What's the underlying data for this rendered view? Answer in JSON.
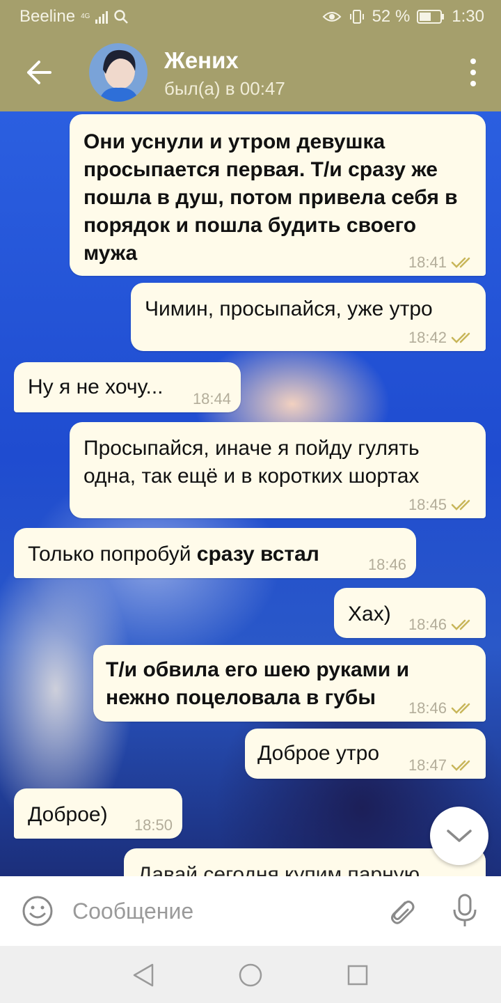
{
  "status_bar": {
    "carrier": "Beeline",
    "network": "4G",
    "battery": "52 %",
    "time": "1:30"
  },
  "header": {
    "contact_name": "Жених",
    "last_seen": "был(а) в 00:47"
  },
  "messages": [
    {
      "direction": "out",
      "text": "Они уснули и утром девушка просыпается первая. Т/и сразу же пошла в душ, потом привела себя в порядок и пошла будить своего мужа",
      "bold": true,
      "time": "18:41",
      "read": true
    },
    {
      "direction": "out",
      "text": "Чимин, просыпайся, уже утро",
      "bold": false,
      "time": "18:42",
      "read": true
    },
    {
      "direction": "in",
      "text": "Ну я не хочу...",
      "time": "18:44"
    },
    {
      "direction": "out",
      "text": "Просыпайся, иначе я пойду гулять одна, так ещё и в коротких шортах",
      "bold": false,
      "time": "18:45",
      "read": true
    },
    {
      "direction": "in",
      "text_plain": "Только попробуй ",
      "text_bold": "сразу встал",
      "time": "18:46"
    },
    {
      "direction": "out",
      "text": "Хах)",
      "bold": false,
      "time": "18:46",
      "read": true
    },
    {
      "direction": "out",
      "text": "Т/и обвила его шею руками и нежно поцеловала в губы",
      "bold": true,
      "time": "18:46",
      "read": true
    },
    {
      "direction": "out",
      "text": "Доброе утро",
      "bold": false,
      "time": "18:47",
      "read": true
    },
    {
      "direction": "in",
      "text": "Доброе)",
      "time": "18:50"
    },
    {
      "direction": "out",
      "text": "Давай сегодня купим парную",
      "bold": false,
      "partial": true
    }
  ],
  "composer": {
    "placeholder": "Сообщение"
  },
  "colors": {
    "header_bg": "#a59f6c",
    "bubble_bg": "#fffbea",
    "tick_color": "#c8b65a",
    "time_color": "#b3ad9a"
  },
  "icons": [
    "back-arrow-icon",
    "menu-dots-icon",
    "emoji-icon",
    "paperclip-icon",
    "microphone-icon",
    "chevron-down-icon",
    "nav-back-icon",
    "nav-home-icon",
    "nav-recents-icon"
  ]
}
